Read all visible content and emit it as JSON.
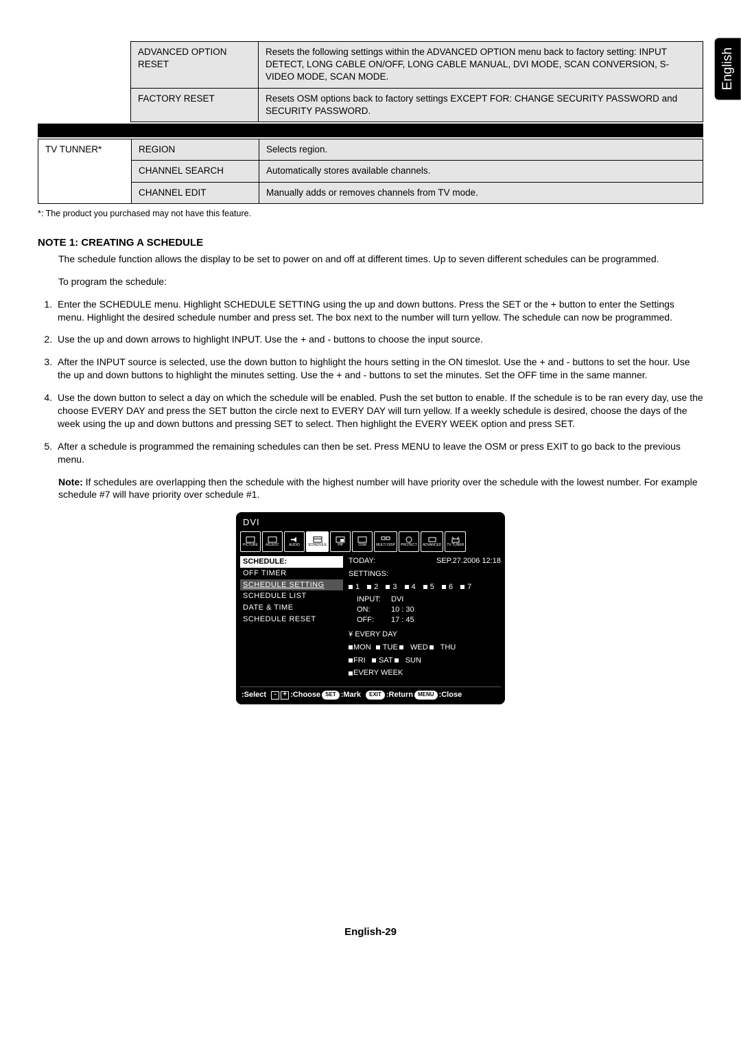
{
  "language_tab": "English",
  "table1": {
    "rows": [
      {
        "label": "ADVANCED OPTION RESET",
        "desc": "Resets the following settings within the ADVANCED OPTION menu back to factory setting: INPUT DETECT, LONG CABLE ON/OFF, LONG CABLE MANUAL, DVI MODE, SCAN CONVERSION, S-VIDEO MODE, SCAN MODE."
      },
      {
        "label": "FACTORY RESET",
        "desc": "Resets OSM options back to factory settings EXCEPT FOR: CHANGE SECURITY PASSWORD and SECURITY PASSWORD."
      }
    ]
  },
  "table2": {
    "rowhead": "TV TUNNER*",
    "rows": [
      {
        "label": "REGION",
        "desc": "Selects region."
      },
      {
        "label": "CHANNEL SEARCH",
        "desc": "Automatically stores available channels."
      },
      {
        "label": "CHANNEL EDIT",
        "desc": "Manually adds or removes channels from TV mode."
      }
    ]
  },
  "footnote": "*: The product you purchased may not have this feature.",
  "note": {
    "heading": "NOTE 1: CREATING A SCHEDULE",
    "intro": "The schedule function allows the display to be set to power on and off at different times. Up to seven different schedules can be programmed.",
    "program_intro": "To program the schedule:",
    "steps": [
      "Enter the SCHEDULE menu. Highlight SCHEDULE SETTING using the up and down buttons. Press the SET or the + button to enter the Settings menu. Highlight the desired schedule number and press set. The box next to the number will turn yellow. The schedule can now be programmed.",
      "Use the up and down arrows to highlight INPUT. Use the + and - buttons to choose the input source.",
      "After the INPUT source is selected, use the down button to highlight the hours setting in the ON timeslot. Use the + and - buttons to set the hour. Use the up and down buttons to highlight the minutes setting. Use the + and - buttons to set the minutes. Set the OFF time in the same manner.",
      "Use the down button to select a day on which the schedule will be enabled. Push the set button to enable. If the schedule is to be ran every day, use the choose EVERY DAY and press the SET button the circle next to EVERY DAY will turn yellow. If a weekly schedule is desired, choose the days of the week using the up and down buttons and pressing SET to select. Then highlight the EVERY WEEK option and press SET.",
      "After a schedule is programmed the remaining schedules can then be set. Press MENU to leave the OSM or press EXIT to go back to the previous menu."
    ],
    "after_note_bold": "Note:",
    "after_note": " If schedules are overlapping then the schedule with the highest number will have priority over the schedule with the lowest number. For example schedule #7 will have priority over schedule #1."
  },
  "osd": {
    "title": "DVI",
    "tabs": [
      "PICTURE",
      "ADJUST",
      "AUDIO",
      "SCHEDULE",
      "PIP",
      "OSM",
      "MULTI DISP",
      "PROTECT",
      "ADVANCED",
      "TV TUNER"
    ],
    "left": {
      "header": "SCHEDULE:",
      "items": [
        "OFF TIMER",
        "SCHEDULE SETTING",
        "SCHEDULE LIST",
        "DATE & TIME",
        "SCHEDULE RESET"
      ],
      "highlighted_index": 1
    },
    "right": {
      "today_label": "TODAY:",
      "today_value": "SEP.27.2006 12:18",
      "settings_label": "SETTINGS:",
      "numbers": [
        "1",
        "2",
        "3",
        "4",
        "5",
        "6",
        "7"
      ],
      "input_label": "INPUT:",
      "input_value": "DVI",
      "on_label": "ON:",
      "on_value": "10 : 30",
      "off_label": "OFF:",
      "off_value": "17 : 45",
      "every_day_prefix": "¥",
      "every_day": "EVERY DAY",
      "days_row1": [
        "MON",
        "TUE",
        "WED",
        "THU"
      ],
      "days_row2": [
        "FRI",
        "SAT",
        "SUN"
      ],
      "every_week": "EVERY WEEK"
    },
    "footer": {
      "select": ":Select",
      "choose": ":Choose",
      "mark": ":Mark",
      "return": ":Return",
      "close": ":Close",
      "set": "SET",
      "exit": "EXIT",
      "menu": "MENU"
    }
  },
  "page_number": "English-29"
}
